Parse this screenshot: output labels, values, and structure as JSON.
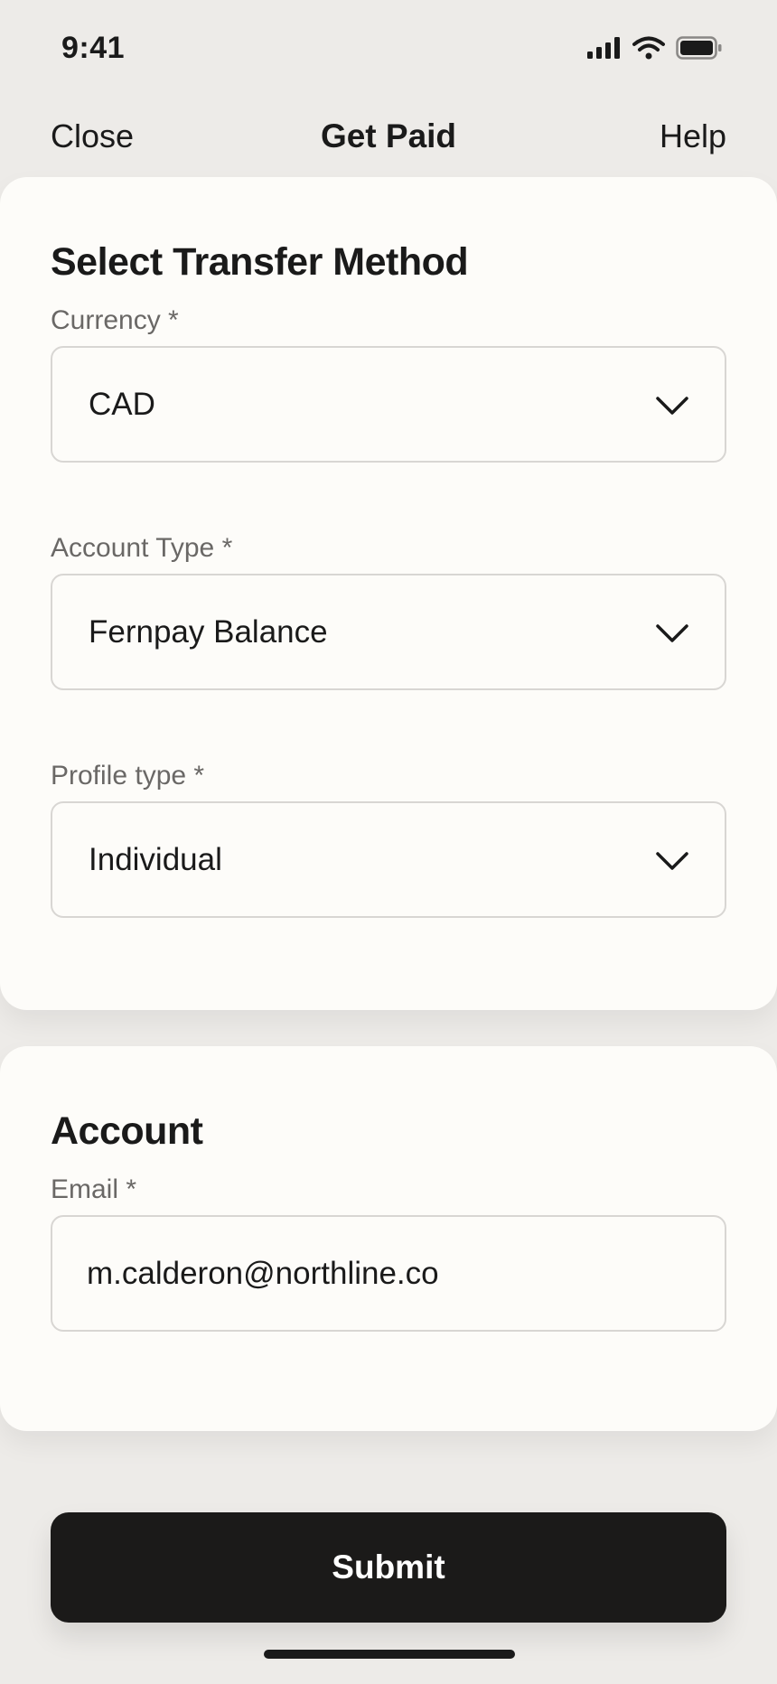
{
  "status_bar": {
    "time": "9:41",
    "icons": [
      "cellular-signal-icon",
      "wifi-icon",
      "battery-icon"
    ]
  },
  "nav": {
    "close_label": "Close",
    "title": "Get Paid",
    "help_label": "Help"
  },
  "transfer_method": {
    "title": "Select Transfer Method",
    "fields": [
      {
        "label": "Currency *",
        "value": "CAD",
        "icon": "chevron-down-icon"
      },
      {
        "label": "Account Type *",
        "value": "Fernpay Balance",
        "icon": "chevron-down-icon"
      },
      {
        "label": "Profile type *",
        "value": "Individual",
        "icon": "chevron-down-icon"
      }
    ]
  },
  "account": {
    "title": "Account",
    "email_label": "Email *",
    "email_value": "m.calderon@northline.co"
  },
  "submit_label": "Submit",
  "colors": {
    "background": "#edebe8",
    "card": "#fdfcf9",
    "text_primary": "#1a1a1a",
    "text_label": "#6a6866",
    "field_border": "#d8d6d3",
    "button": "#1b1a19",
    "button_text": "#ffffff"
  }
}
